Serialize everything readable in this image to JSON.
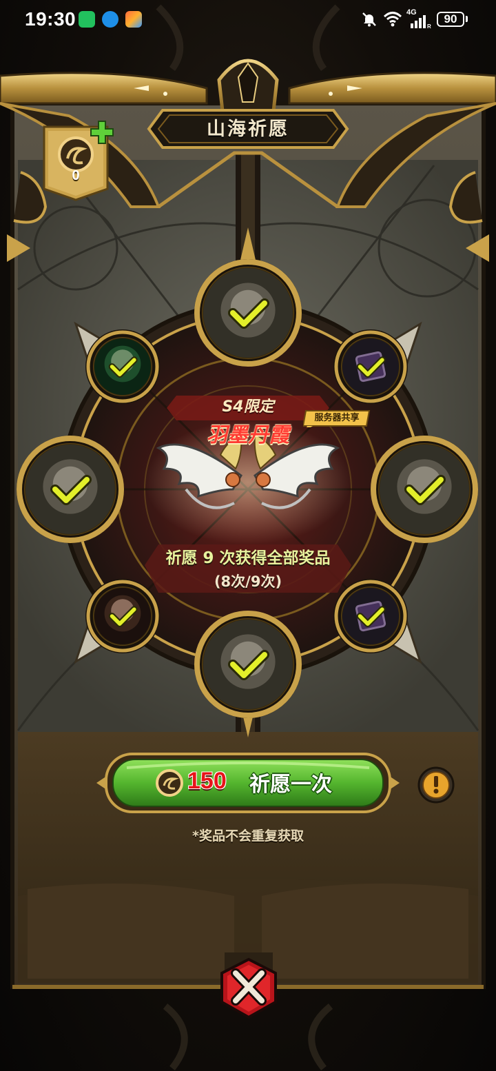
{
  "status_bar": {
    "time": "19:30",
    "network": "4G",
    "battery": "90",
    "icons": [
      "wechat-icon",
      "browser-icon",
      "app-store-icon",
      "mute-icon",
      "wifi-icon",
      "signal-icon",
      "battery-icon"
    ]
  },
  "header": {
    "title": "山海祈愿"
  },
  "currency": {
    "icon": "coin-icon",
    "count": "0",
    "add_icon": "plus-icon"
  },
  "featured": {
    "season_label": "S4限定",
    "reward_name": "羽墨丹霞",
    "server_tag": "服务器共享",
    "wish_info": "祈愿 9 次获得全部奖品",
    "wish_progress": "(8次/9次)"
  },
  "rewards": [
    {
      "slot": "top",
      "kind": "character",
      "claimed": true
    },
    {
      "slot": "upper-left",
      "kind": "pet",
      "claimed": true
    },
    {
      "slot": "upper-right",
      "kind": "item",
      "claimed": true
    },
    {
      "slot": "left",
      "kind": "character",
      "claimed": true
    },
    {
      "slot": "right",
      "kind": "character",
      "claimed": true
    },
    {
      "slot": "lower-left",
      "kind": "frame",
      "claimed": true
    },
    {
      "slot": "lower-right",
      "kind": "item",
      "claimed": true
    },
    {
      "slot": "bottom",
      "kind": "character",
      "claimed": true
    }
  ],
  "wish_button": {
    "cost": "150",
    "label": "祈愿一次"
  },
  "note": "*奖品不会重复获取",
  "colors": {
    "gold": "#c9a24a",
    "button_green": "#5cc036",
    "cost_red": "#e8141a",
    "check_yellow": "#e3ef2a",
    "reward_red": "#ff3b33"
  }
}
